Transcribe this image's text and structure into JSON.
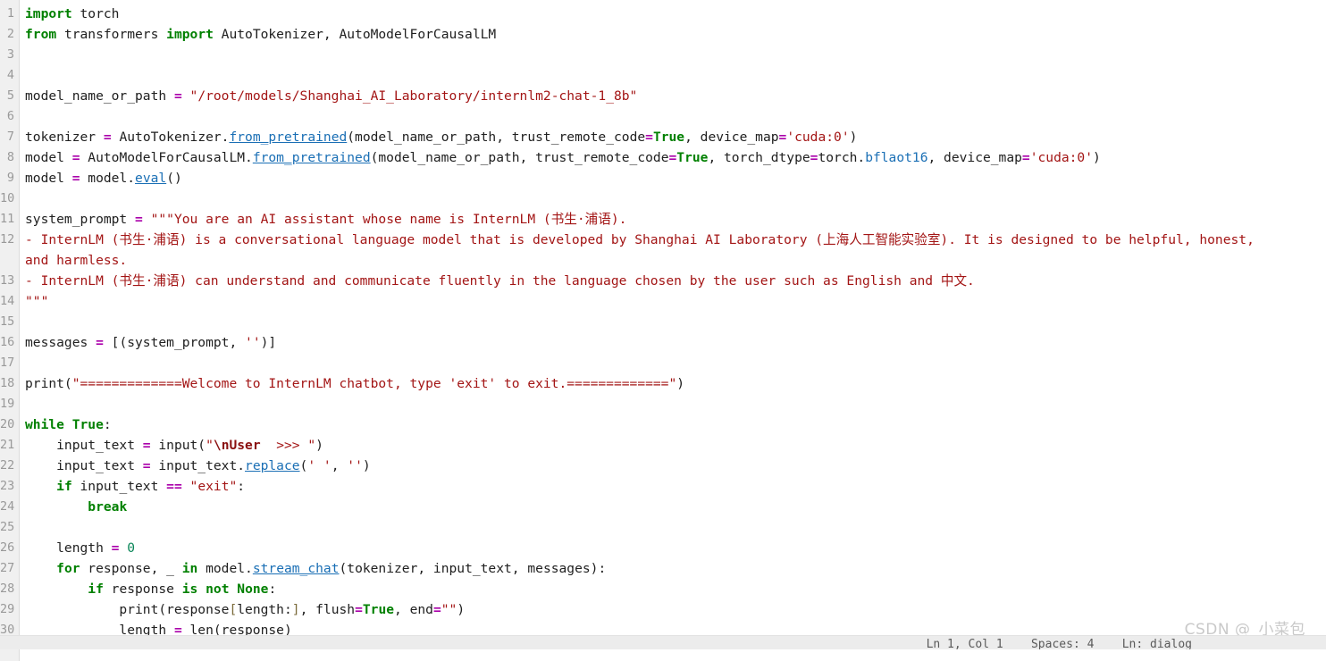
{
  "editor": {
    "language": "python",
    "background": "#ffffff",
    "gutter_background": "#f0f0f0",
    "line_number_color": "#999999",
    "colors": {
      "keyword": "#008000",
      "string": "#a31515",
      "operator": "#aa00aa",
      "function": "#1a6fb5",
      "number": "#098658",
      "text": "#202020"
    },
    "line_numbers": [
      "1",
      "2",
      "3",
      "4",
      "5",
      "6",
      "7",
      "8",
      "9",
      "10",
      "11",
      "12",
      "",
      "13",
      "14",
      "15",
      "16",
      "17",
      "18",
      "19",
      "20",
      "21",
      "22",
      "23",
      "24",
      "25",
      "26",
      "27",
      "28",
      "29",
      "30"
    ],
    "lines": [
      {
        "n": "1",
        "text": "import torch"
      },
      {
        "n": "2",
        "text": "from transformers import AutoTokenizer, AutoModelForCausalLM"
      },
      {
        "n": "3",
        "text": ""
      },
      {
        "n": "4",
        "text": ""
      },
      {
        "n": "5",
        "text": "model_name_or_path = \"/root/models/Shanghai_AI_Laboratory/internlm2-chat-1_8b\""
      },
      {
        "n": "6",
        "text": ""
      },
      {
        "n": "7",
        "text": "tokenizer = AutoTokenizer.from_pretrained(model_name_or_path, trust_remote_code=True, device_map='cuda:0')"
      },
      {
        "n": "8",
        "text": "model = AutoModelForCausalLM.from_pretrained(model_name_or_path, trust_remote_code=True, torch_dtype=torch.bflaot16, device_map='cuda:0')"
      },
      {
        "n": "9",
        "text": "model = model.eval()"
      },
      {
        "n": "10",
        "text": ""
      },
      {
        "n": "11",
        "text": "system_prompt = \"\"\"You are an AI assistant whose name is InternLM (书生·浦语)."
      },
      {
        "n": "12",
        "text": "- InternLM (书生·浦语) is a conversational language model that is developed by Shanghai AI Laboratory (上海人工智能实验室). It is designed to be helpful, honest,"
      },
      {
        "n": "",
        "text": "and harmless."
      },
      {
        "n": "13",
        "text": "- InternLM (书生·浦语) can understand and communicate fluently in the language chosen by the user such as English and 中文."
      },
      {
        "n": "14",
        "text": "\"\"\""
      },
      {
        "n": "15",
        "text": ""
      },
      {
        "n": "16",
        "text": "messages = [(system_prompt, '')]"
      },
      {
        "n": "17",
        "text": ""
      },
      {
        "n": "18",
        "text": "print(\"=============Welcome to InternLM chatbot, type 'exit' to exit.=============\")"
      },
      {
        "n": "19",
        "text": ""
      },
      {
        "n": "20",
        "text": "while True:"
      },
      {
        "n": "21",
        "text": "    input_text = input(\"\\nUser  >>> \")"
      },
      {
        "n": "22",
        "text": "    input_text = input_text.replace(' ', '')"
      },
      {
        "n": "23",
        "text": "    if input_text == \"exit\":"
      },
      {
        "n": "24",
        "text": "        break"
      },
      {
        "n": "25",
        "text": ""
      },
      {
        "n": "26",
        "text": "    length = 0"
      },
      {
        "n": "27",
        "text": "    for response, _ in model.stream_chat(tokenizer, input_text, messages):"
      },
      {
        "n": "28",
        "text": "        if response is not None:"
      },
      {
        "n": "29",
        "text": "            print(response[length:], flush=True, end=\"\")"
      },
      {
        "n": "30",
        "text": "            length = len(response)"
      }
    ]
  },
  "watermark": {
    "text": "CSDN @_小菜包_",
    "color": "#c9c9c9"
  },
  "statusbar": {
    "text": "Ln 1, Col 1    Spaces: 4    Ln: dialog"
  }
}
